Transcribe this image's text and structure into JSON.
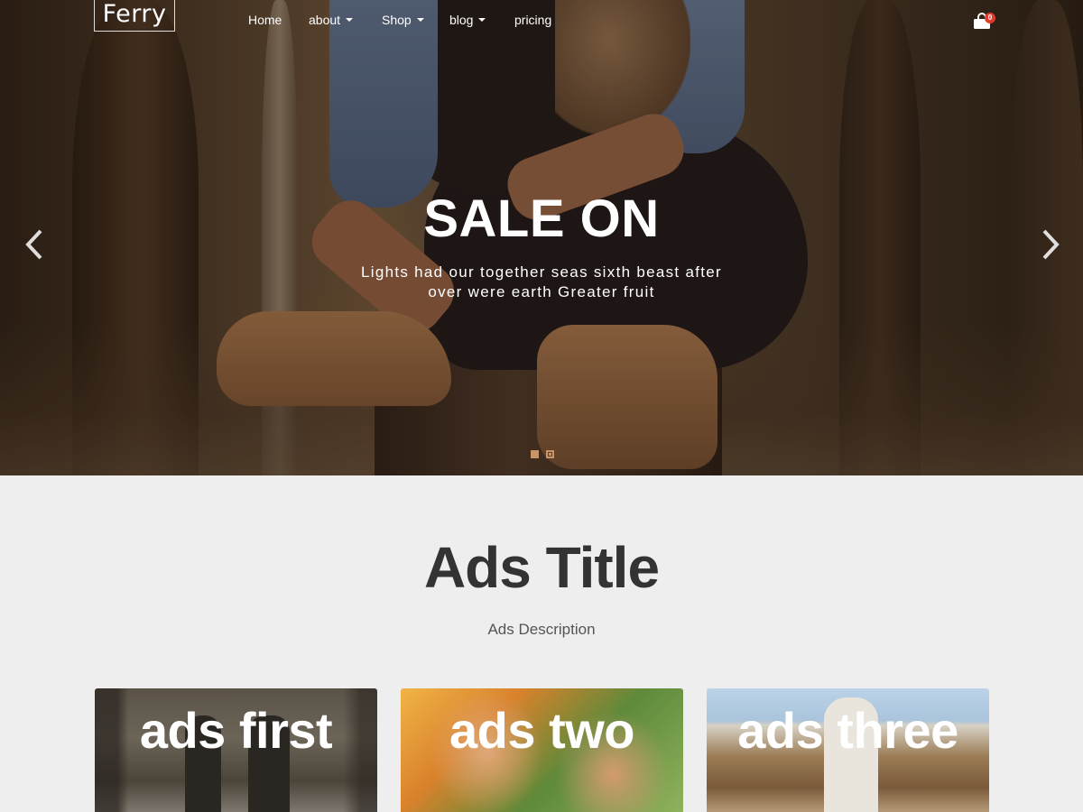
{
  "brand": {
    "logo_text": "Ferry"
  },
  "nav": {
    "items": [
      {
        "label": "Home",
        "has_dropdown": false
      },
      {
        "label": "about",
        "has_dropdown": true
      },
      {
        "label": "Shop",
        "has_dropdown": true
      },
      {
        "label": "blog",
        "has_dropdown": true
      },
      {
        "label": "pricing",
        "has_dropdown": false
      }
    ],
    "cart": {
      "icon": "shopping-bag-icon",
      "count": "0"
    }
  },
  "hero": {
    "title": "SALE ON",
    "subtitle": "Lights had our together seas sixth beast after over were earth Greater fruit",
    "prev_icon": "chevron-left-icon",
    "next_icon": "chevron-right-icon",
    "slide_count": 2,
    "active_slide": 2
  },
  "ads": {
    "title": "Ads Title",
    "description": "Ads Description",
    "cards": [
      {
        "label": "ads first"
      },
      {
        "label": "ads two"
      },
      {
        "label": "ads three"
      }
    ]
  },
  "colors": {
    "accent": "#c89468",
    "badge": "#e23a2e",
    "section_bg": "#eeeeee",
    "heading": "#333333"
  }
}
